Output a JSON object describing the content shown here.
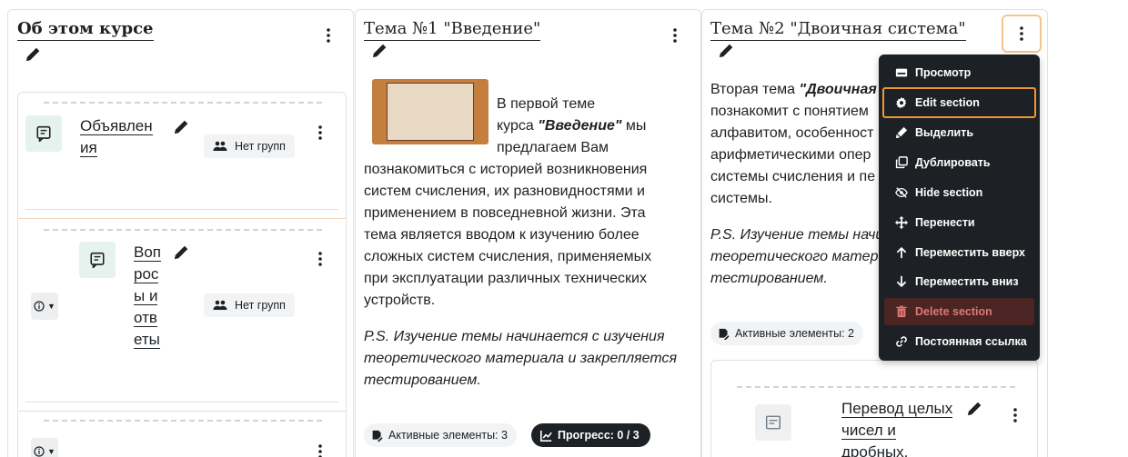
{
  "col1": {
    "title": "Об этом курсе",
    "activity1": {
      "name": "Объявления",
      "name_lines": [
        "Объявлен",
        "ия"
      ],
      "group": "Нет групп"
    },
    "activity2": {
      "name_lines": [
        "Воп",
        "рос",
        "ы и",
        "отв",
        "еты"
      ],
      "group": "Нет групп"
    }
  },
  "col2": {
    "title": "Тема №1 \"Введение\"",
    "text_lines_1": [
      "В первой теме",
      "курса",
      "\"Введение\"",
      "мы",
      "предлагаем Вам"
    ],
    "text_lines_2": [
      "познакомиться с историей возникновения",
      "систем счисления, их разновидностями и",
      "применением в повседневной жизни. Эта",
      "тема является вводом к изучению более",
      "сложных систем счисления, применяемых",
      "при эксплуатации различных технических",
      "устройств."
    ],
    "ps_lines": [
      "P.S. Изучение темы начинается с изучения",
      "теоретического материала и закрепляется",
      "тестированием."
    ],
    "active_badge": "Активные элементы: 3",
    "progress_badge": "Прогресс: 0 / 3"
  },
  "col3": {
    "title": "Тема №2 \"Двоичная система\"",
    "text_lines": [
      "Вторая тема",
      "\"Двоичная",
      "познакомит с понятием",
      "алфавитом, особенност",
      "арифметическими опер",
      "системы счисления и пе",
      "системы."
    ],
    "ps_lines": [
      "P.S. Изучение темы начи",
      "теоретического матер",
      "тестированием."
    ],
    "active_badge": "Активные элементы: 2",
    "sub_activity_lines": [
      "Перевод целых",
      "чисел и",
      "дробных."
    ]
  },
  "menu": {
    "items": [
      {
        "label": "Просмотр",
        "icon": "view-icon"
      },
      {
        "label": "Edit section",
        "icon": "gear-icon"
      },
      {
        "label": "Выделить",
        "icon": "highlight-icon"
      },
      {
        "label": "Дублировать",
        "icon": "duplicate-icon"
      },
      {
        "label": "Hide section",
        "icon": "eye-slash-icon"
      },
      {
        "label": "Перенести",
        "icon": "move-icon"
      },
      {
        "label": "Переместить вверх",
        "icon": "arrow-up-icon"
      },
      {
        "label": "Переместить вниз",
        "icon": "arrow-down-icon"
      },
      {
        "label": "Delete section",
        "icon": "trash-icon"
      },
      {
        "label": "Постоянная ссылка",
        "icon": "link-icon"
      }
    ]
  },
  "colors": {
    "accent": "#f0952e",
    "menu_bg": "#1d2125",
    "danger_bg": "#4b2424",
    "danger_text": "#e07870",
    "icon_bg": "#e6f2ee"
  }
}
